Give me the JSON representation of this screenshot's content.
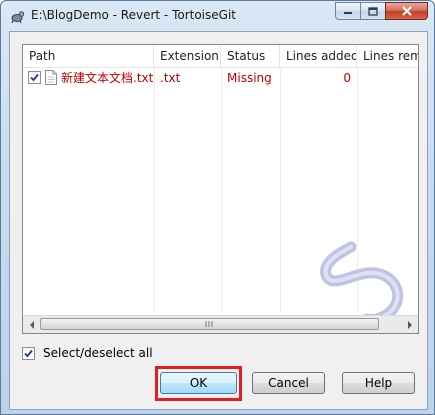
{
  "window": {
    "title": "E:\\BlogDemo - Revert - TortoiseGit",
    "icon": "tortoisegit-icon"
  },
  "list": {
    "columns": [
      "Path",
      "Extension",
      "Status",
      "Lines added",
      "Lines removed"
    ],
    "rows": [
      {
        "checked": true,
        "path": "新建文本文档.txt",
        "extension": ".txt",
        "status": "Missing",
        "lines_added": "0",
        "lines_removed": ""
      }
    ]
  },
  "select_all": {
    "label": "Select/deselect all",
    "checked": true
  },
  "buttons": {
    "ok": "OK",
    "cancel": "Cancel",
    "help": "Help"
  },
  "colors": {
    "row_text": "#c00000",
    "highlight_box": "#e02020",
    "watermark": "#b9bddf"
  }
}
